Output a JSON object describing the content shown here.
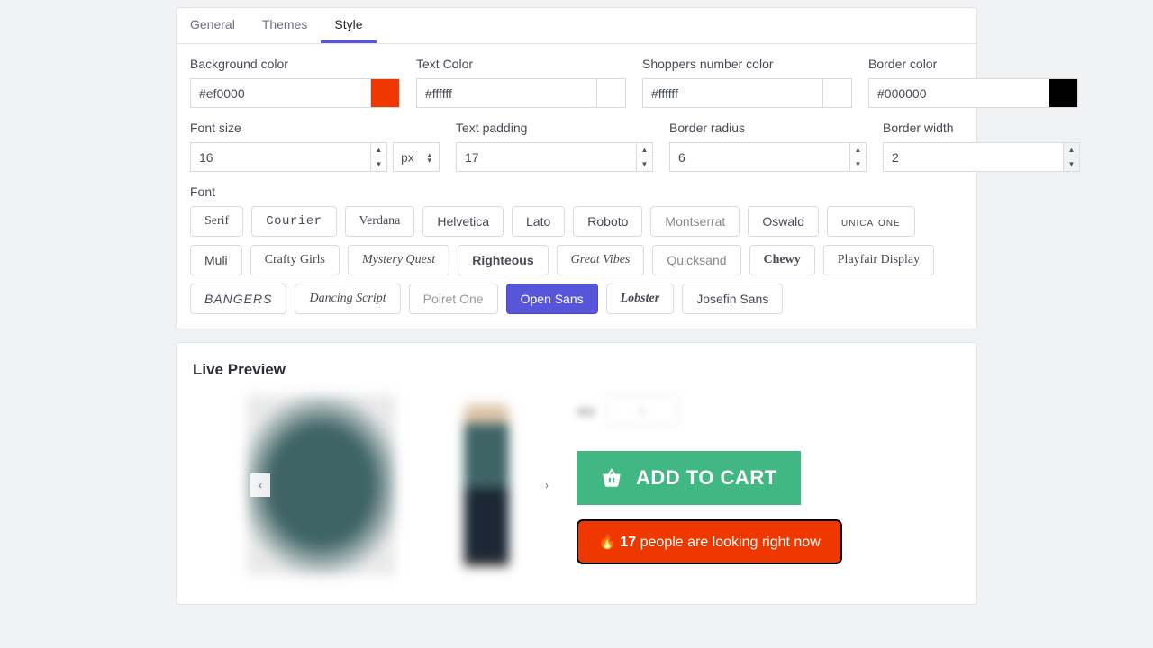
{
  "tabs": {
    "general": "General",
    "themes": "Themes",
    "style": "Style"
  },
  "labels": {
    "bg_color": "Background color",
    "text_color": "Text Color",
    "shoppers_color": "Shoppers number color",
    "border_color": "Border color",
    "font_size": "Font size",
    "text_padding": "Text padding",
    "border_radius": "Border radius",
    "border_width": "Border width",
    "font": "Font"
  },
  "values": {
    "bg_color": "#ef0000",
    "text_color": "#ffffff",
    "shoppers_color": "#ffffff",
    "border_color": "#000000",
    "font_size": "16",
    "font_size_unit": "px",
    "text_padding": "17",
    "border_radius": "6",
    "border_width": "2"
  },
  "swatches": {
    "bg_color": "#ef3700",
    "text_color": "#ffffff",
    "shoppers_color": "#ffffff",
    "border_color": "#000000"
  },
  "fonts": [
    {
      "label": "Serif",
      "class": "f-serif"
    },
    {
      "label": "Courier",
      "class": "f-courier"
    },
    {
      "label": "Verdana",
      "class": "f-verdana"
    },
    {
      "label": "Helvetica",
      "class": "f-helvetica"
    },
    {
      "label": "Lato",
      "class": "f-lato"
    },
    {
      "label": "Roboto",
      "class": "f-roboto"
    },
    {
      "label": "Montserrat",
      "class": "f-montserrat"
    },
    {
      "label": "Oswald",
      "class": "f-oswald"
    },
    {
      "label": "unica one",
      "class": "f-unica"
    },
    {
      "label": "Muli",
      "class": "f-muli"
    },
    {
      "label": "Crafty Girls",
      "class": "f-crafty"
    },
    {
      "label": "Mystery Quest",
      "class": "f-mystery"
    },
    {
      "label": "Righteous",
      "class": "f-righteous"
    },
    {
      "label": "Great Vibes",
      "class": "f-greatvibes"
    },
    {
      "label": "Quicksand",
      "class": "f-quicksand"
    },
    {
      "label": "Chewy",
      "class": "f-chewy"
    },
    {
      "label": "Playfair Display",
      "class": "f-playfair"
    },
    {
      "label": "BANGERS",
      "class": "f-bangers"
    },
    {
      "label": "Dancing Script",
      "class": "f-dancing"
    },
    {
      "label": "Poiret One",
      "class": "f-poiret"
    },
    {
      "label": "Open Sans",
      "class": "",
      "selected": true
    },
    {
      "label": "Lobster",
      "class": "f-lobster"
    },
    {
      "label": "Josefin Sans",
      "class": "f-josefin"
    }
  ],
  "preview": {
    "title": "Live Preview",
    "cart_label": "ADD TO CART",
    "fire": "🔥",
    "shoppers_count": "17",
    "shoppers_text": " people are looking right now"
  }
}
